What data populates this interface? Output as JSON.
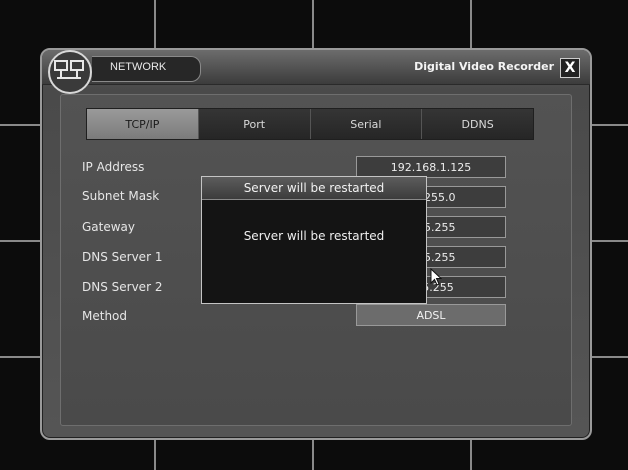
{
  "window": {
    "section_title": "NETWORK",
    "app_title": "Digital Video Recorder",
    "close_label": "X"
  },
  "tabs": [
    {
      "label": "TCP/IP",
      "active": true
    },
    {
      "label": "Port",
      "active": false
    },
    {
      "label": "Serial",
      "active": false
    },
    {
      "label": "DDNS",
      "active": false
    }
  ],
  "form": {
    "ip_address": {
      "label": "IP Address",
      "value": "192.168.1.125"
    },
    "subnet_mask": {
      "label": "Subnet Mask",
      "value": "55.255.0"
    },
    "gateway": {
      "label": "Gateway",
      "value": ".255.255"
    },
    "dns1": {
      "label": "DNS Server 1",
      "value": ".255.255"
    },
    "dns2": {
      "label": "DNS Server 2",
      "value": "255.255"
    },
    "method": {
      "label": "Method",
      "value": "ADSL"
    }
  },
  "dialog": {
    "title": "Server will be restarted",
    "message": "Server will be restarted"
  },
  "icons": {
    "logo": "network-logo-icon",
    "close": "close-icon",
    "cursor": "mouse-cursor-icon"
  }
}
